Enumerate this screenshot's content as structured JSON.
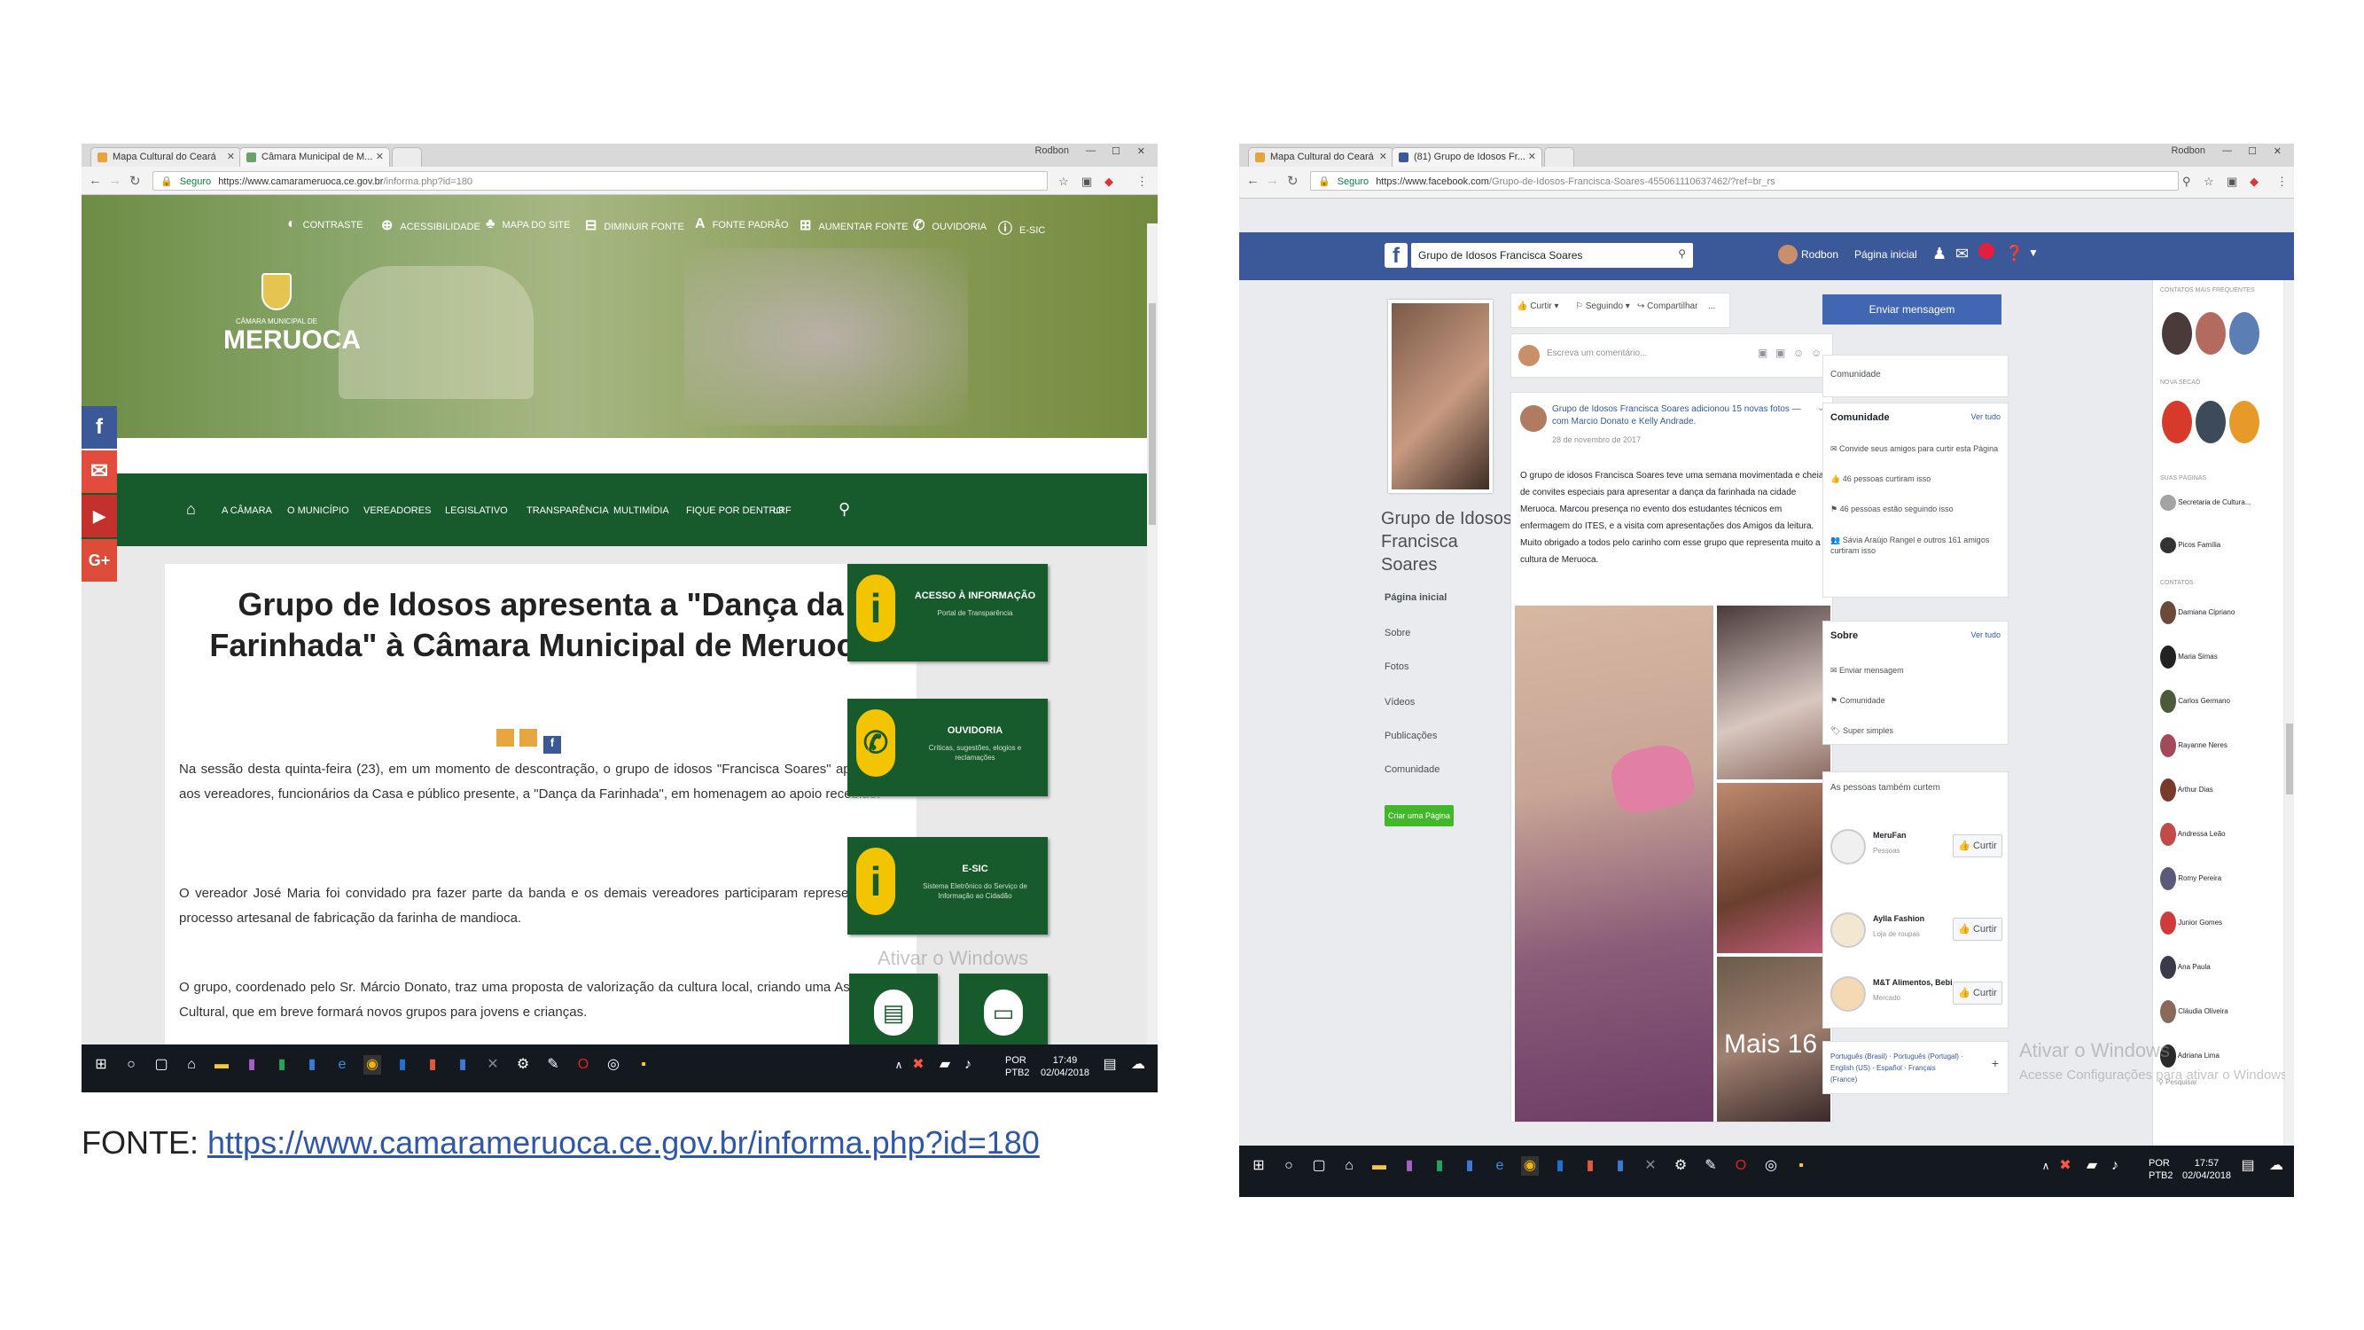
{
  "source": {
    "prefix": "FONTE:",
    "url": "https://www.camarameruoca.ce.gov.br/informa.php?id=180"
  },
  "left_window": {
    "tabs": [
      {
        "label": "Mapa Cultural do Ceará"
      },
      {
        "label": "Câmara Municipal de M..."
      }
    ],
    "window_user": "Rodbon",
    "address": {
      "secure": "Seguro",
      "url": "https://www.camarameruoca.ce.gov.br",
      "path": "/informa.php?id=180"
    },
    "top_links": [
      "CONTRASTE",
      "ACESSIBILIDADE",
      "MAPA DO SITE",
      "DIMINUIR FONTE",
      "FONTE PADRÃO",
      "AUMENTAR FONTE",
      "OUVIDORIA",
      "E-SIC"
    ],
    "brand": {
      "line1": "CÂMARA MUNICIPAL DE",
      "line2": "MERUOCA"
    },
    "menu": [
      "A CÂMARA",
      "O MUNICÍPIO",
      "VEREADORES",
      "LEGISLATIVO",
      "TRANSPARÊNCIA",
      "MULTIMÍDIA",
      "FIQUE POR DENTRO",
      "LRF"
    ],
    "social": [
      "f",
      "✉",
      "▶",
      "G+"
    ],
    "article": {
      "title_line1": "Grupo de Idosos apresenta a \"Dança da",
      "title_line2": "Farinhada\" à Câmara Municipal de Meruoca",
      "paragraphs": [
        "Na sessão desta quinta-feira (23), em um momento de descontração, o grupo de idosos \"Francisca Soares\" apresentou aos vereadores, funcionários da Casa e público presente, a \"Dança da Farinhada\", em homenagem ao apoio recebido.",
        "O vereador José Maria foi convidado pra fazer parte da banda e os demais vereadores participaram representando o processo artesanal de fabricação da farinha de mandioca.",
        "O grupo, coordenado pelo Sr. Márcio Donato, traz uma proposta de valorização da cultura local, criando uma Associação Cultural, que em breve formará novos grupos para jovens e crianças."
      ]
    },
    "side_cards": [
      {
        "title": "ACESSO À INFORMAÇÃO",
        "sub": "Portal de Transparência"
      },
      {
        "title": "OUVIDORIA",
        "sub": "Críticas, sugestões, elogios e reclamações"
      },
      {
        "title": "E-SIC",
        "sub": "Sistema Eletrônico do Serviço de Informação ao Cidadão"
      }
    ],
    "watermark": "Ativar o Windows",
    "taskbar": {
      "lang": "POR",
      "kbd": "PTB2",
      "time": "17:49",
      "date": "02/04/2018"
    }
  },
  "right_window": {
    "tabs": [
      {
        "label": "Mapa Cultural do Ceará"
      },
      {
        "label": "(81) Grupo de Idosos Fr..."
      }
    ],
    "window_user": "Rodbon",
    "address": {
      "secure": "Seguro",
      "url": "https://www.facebook.com",
      "path": "/Grupo-de-Idosos-Francisca-Soares-455061110637462/?ref=br_rs"
    },
    "fb": {
      "search": "Grupo de Idosos Francisca Soares",
      "user": "Rodbon",
      "home": "Página inicial",
      "page_name": "Grupo de Idosos Francisca Soares",
      "left_nav": [
        "Página inicial",
        "Sobre",
        "Fotos",
        "Vídeos",
        "Publicações",
        "Comunidade"
      ],
      "create_page": "Criar uma Página",
      "actions": [
        "Curtir",
        "Seguindo",
        "Compartilhar",
        "..."
      ],
      "composer": "Escreva um comentário...",
      "post": {
        "header": "Grupo de Idosos Francisca Soares adicionou 15 novas fotos — com Marcio Donato e Kelly Andrade.",
        "date": "28 de novembro de 2017",
        "text": "O grupo de idosos Francisca Soares teve uma semana movimentada e cheia de convites especiais para apresentar a dança da farinhada na cidade Meruoca. Marcou presença no evento dos estudantes técnicos em enfermagem do ITES, e a visita com apresentações dos Amigos da leitura. Muito obrigado a todos pelo carinho com esse grupo que representa muito a cultura de Meruoca.",
        "more": "Mais 16"
      },
      "send_message": "Enviar mensagem",
      "community_label": "Comunidade",
      "community_title": "Comunidade",
      "see_all": "Ver tudo",
      "community_items": [
        "Convide seus amigos para curtir esta Página",
        "46 pessoas curtiram isso",
        "46 pessoas estão seguindo isso",
        "Sávia Araújo Rangel e outros 161 amigos curtiram isso"
      ],
      "about_title": "Sobre",
      "about_items": [
        "Enviar mensagem",
        "Comunidade",
        "Super simples"
      ],
      "also_like_title": "As pessoas também curtem",
      "also_like": [
        {
          "name": "MeruFan",
          "cat": "Pessoas",
          "btn": "Curtir"
        },
        {
          "name": "Aylla Fashion",
          "cat": "Loja de roupas",
          "btn": "Curtir"
        },
        {
          "name": "M&T Alimentos, Bebi...",
          "cat": "Mercado",
          "btn": "Curtir"
        }
      ],
      "langs": "Português (Brasil) · Português (Portugal) · English (US) · Español · Français (France)",
      "chat_sections": [
        "CONTATOS MAIS FREQUENTES",
        "NOVA SECAO",
        "SUAS PÁGINAS",
        "CONTATOS"
      ],
      "pages": [
        "Secretaria de Cultura...",
        "Picos Família"
      ],
      "contacts": [
        "Damiana Cipriano",
        "Maria Simas",
        "Carlos Germano",
        "Rayanne Neres",
        "Arthur Dias",
        "Andressa Leão",
        "Romy Pereira",
        "Junior Gomes",
        "Ana Paula",
        "Cláudia Oliveira",
        "Adriana Lima"
      ],
      "chat_search": "Pesquisar",
      "watermark": "Ativar o Windows",
      "watermark_sub": "Acesse Configurações para ativar o Windows."
    },
    "taskbar": {
      "lang": "POR",
      "kbd": "PTB2",
      "time": "17:57",
      "date": "02/04/2018"
    }
  },
  "colors": {
    "meruoca_green": "#175a2c",
    "facebook_blue": "#3b5998",
    "bulb_yellow": "#f2c500",
    "taskbar": "#14191f"
  }
}
